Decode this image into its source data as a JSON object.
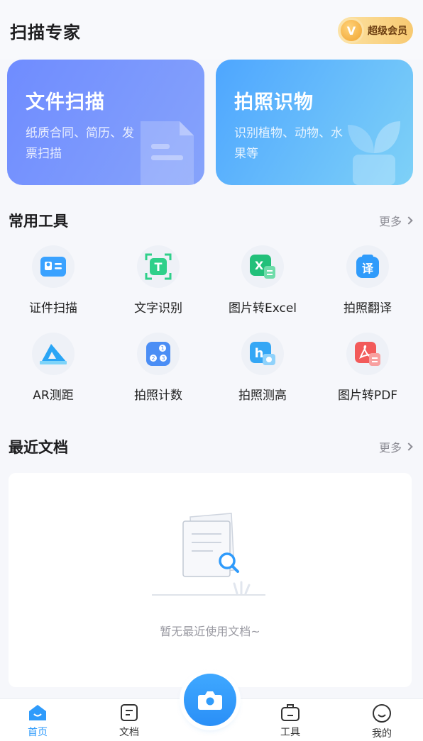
{
  "header": {
    "title": "扫描专家",
    "vip_icon_glyph": "V",
    "vip_label": "超级会员"
  },
  "cards": [
    {
      "title": "文件扫描",
      "desc": "纸质合同、简历、发票扫描",
      "icon": "document-icon"
    },
    {
      "title": "拍照识物",
      "desc": "识别植物、动物、水果等",
      "icon": "plant-icon"
    }
  ],
  "tools_section": {
    "title": "常用工具",
    "more": "更多",
    "items": [
      {
        "label": "证件扫描",
        "icon": "id-card-icon",
        "color": "#3aa2ff"
      },
      {
        "label": "文字识别",
        "icon": "text-recognition-icon",
        "color": "#2fd08a"
      },
      {
        "label": "图片转Excel",
        "icon": "excel-icon",
        "color": "#22c07a"
      },
      {
        "label": "拍照翻译",
        "icon": "translate-icon",
        "color": "#2f9bfb"
      },
      {
        "label": "AR测距",
        "icon": "ruler-icon",
        "color": "#2aa5f5"
      },
      {
        "label": "拍照计数",
        "icon": "count-icon",
        "color": "#4b8ef5"
      },
      {
        "label": "拍照测高",
        "icon": "height-icon",
        "color": "#35a7f5"
      },
      {
        "label": "图片转PDF",
        "icon": "pdf-icon",
        "color": "#f25a5a"
      }
    ]
  },
  "recent_section": {
    "title": "最近文档",
    "more": "更多",
    "empty_text": "暂无最近使用文档~"
  },
  "nav": {
    "items": [
      {
        "label": "首页",
        "icon": "home-icon",
        "active": true
      },
      {
        "label": "文档",
        "icon": "document-icon"
      },
      {
        "label": "工具",
        "icon": "toolbox-icon"
      },
      {
        "label": "我的",
        "icon": "profile-icon"
      }
    ],
    "camera_icon": "camera-icon"
  },
  "colors": {
    "accent": "#2f9bfb",
    "vip_gold": "#f7c971"
  }
}
